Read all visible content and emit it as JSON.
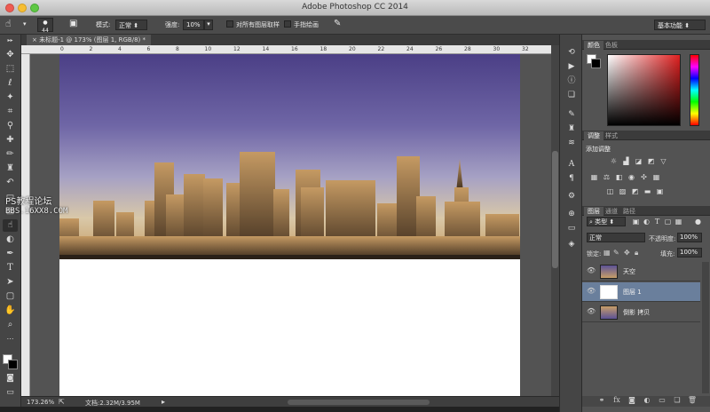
{
  "window": {
    "title": "Adobe Photoshop CC 2014"
  },
  "options_bar": {
    "brush_size": "44",
    "mode_label": "模式:",
    "mode_value": "正常",
    "strength_label": "强度:",
    "strength_value": "10%",
    "sample_all_label": "对所有图层取样",
    "finger_paint_label": "手指绘画",
    "workspace_value": "基本功能"
  },
  "document": {
    "tab_label": "未标题-1 @ 173% (图层 1, RGB/8) *",
    "zoom": "173.26%",
    "doc_size": "文档:2.32M/3.95M",
    "ruler_top": [
      "0",
      "2",
      "4",
      "6",
      "8",
      "10",
      "12",
      "14",
      "16",
      "18",
      "20",
      "22",
      "24",
      "26",
      "28",
      "30",
      "32"
    ],
    "watermark_line1": "PS教程论坛",
    "watermark_line2": "BBS.16XX8.COM"
  },
  "color_panel": {
    "tabs": [
      "颜色",
      "色板"
    ]
  },
  "adjustments_panel": {
    "tabs": [
      "调整",
      "样式"
    ],
    "heading": "添加调整"
  },
  "layers_panel": {
    "tabs": [
      "图层",
      "通道",
      "路径"
    ],
    "filter_kind": "类型",
    "blend_mode": "正常",
    "opacity_label": "不透明度:",
    "opacity_value": "100%",
    "lock_label": "锁定:",
    "fill_label": "填充:",
    "fill_value": "100%",
    "layers": [
      {
        "name": "天空",
        "selected": false
      },
      {
        "name": "图层 1",
        "selected": true
      },
      {
        "name": "倒影 拷贝",
        "selected": false
      }
    ]
  },
  "colors": {
    "selection": "#6a7f9c",
    "hue_red": "#e02020"
  }
}
